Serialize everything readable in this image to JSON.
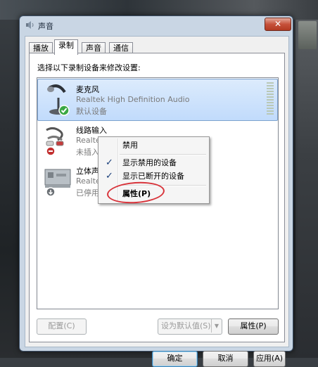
{
  "window": {
    "title": "声音",
    "close_glyph": "✕"
  },
  "tabs": [
    {
      "label": "播放",
      "active": false
    },
    {
      "label": "录制",
      "active": true
    },
    {
      "label": "声音",
      "active": false
    },
    {
      "label": "通信",
      "active": false
    }
  ],
  "instruction": "选择以下录制设备来修改设置:",
  "devices": [
    {
      "name": "麦克风",
      "description": "Realtek High Definition Audio",
      "status": "默认设备",
      "icon": "microphone-icon",
      "badge": "default-check-badge",
      "selected": true
    },
    {
      "name": "线路输入",
      "description": "Realtek High Definition Audio",
      "status": "未插入",
      "icon": "line-in-cable-icon",
      "badge": "unplugged-badge",
      "selected": false
    },
    {
      "name": "立体声混音",
      "description": "Realtek High Definition Audio",
      "status": "已停用",
      "icon": "sound-card-icon",
      "badge": "disabled-badge",
      "selected": false
    }
  ],
  "context_menu": {
    "items": [
      {
        "label": "禁用",
        "checked": false
      },
      {
        "label": "显示禁用的设备",
        "checked": true
      },
      {
        "label": "显示已断开的设备",
        "checked": true
      },
      {
        "label": "属性(P)",
        "checked": false,
        "bold": true
      }
    ],
    "annotation_color": "#d8333a"
  },
  "buttons": {
    "configure": "配置(C)",
    "set_default": "设为默认值(S)",
    "properties": "属性(P)",
    "ok": "确定",
    "cancel": "取消",
    "apply": "应用(A)"
  },
  "accent_color": "#3c7fb1"
}
